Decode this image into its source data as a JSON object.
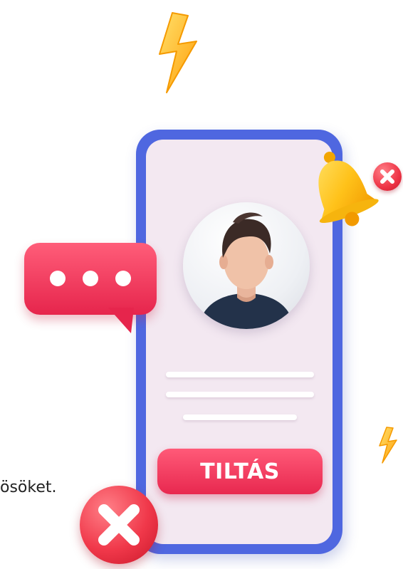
{
  "screen": {
    "block_button_label": "TILTÁS",
    "partial_caption": "ösöket."
  },
  "colors": {
    "phone_frame": "#4f67e0",
    "phone_screen": "#f3e8f1",
    "accent_red": "#e8284f",
    "bell_yellow": "#ffc21a",
    "bolt_orange": "#ffb21c"
  },
  "icons": {
    "top_bolt": "lightning-bolt-icon",
    "small_bolt": "lightning-bolt-icon",
    "bell": "bell-icon",
    "bell_badge": "close-icon",
    "chat_bubble": "chat-bubble-icon",
    "cancel_badge": "close-icon",
    "avatar": "user-avatar"
  }
}
